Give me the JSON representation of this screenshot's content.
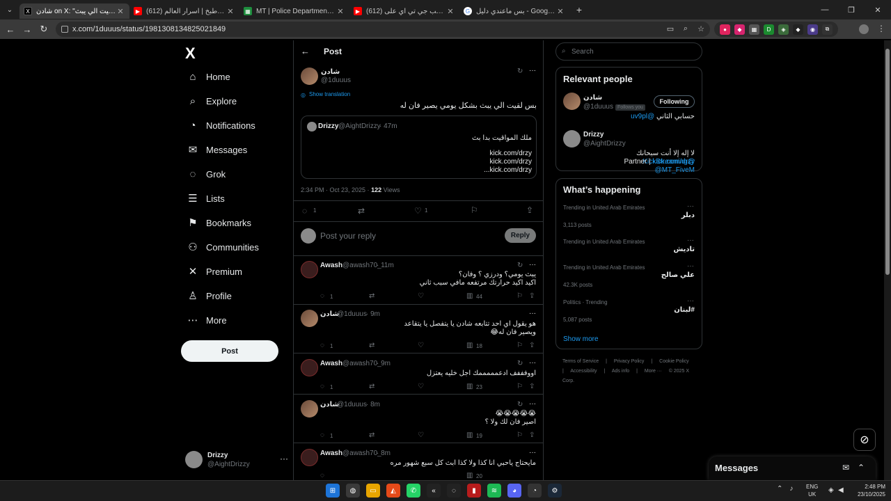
{
  "browser": {
    "tabs": [
      {
        "title": "شادن on X: \"بس لقيت الي يبث",
        "active": true,
        "fav_color": "#000000",
        "fav_glyph": "X"
      },
      {
        "title": "(612) سوالف و طبخ | اسرار العالم",
        "active": false,
        "fav_color": "#ff0000",
        "fav_glyph": "▶"
      },
      {
        "title": "MT | Police Departments v7.0 -",
        "active": false,
        "fav_color": "#1e8e3e",
        "fav_glyph": "▦"
      },
      {
        "title": "(612) كيف تلعب جي تي اي على",
        "active": false,
        "fav_color": "#ff0000",
        "fav_glyph": "▶"
      },
      {
        "title": "بس ماعندي دليل - Google Search",
        "active": false,
        "fav_color": "#ffffff",
        "fav_glyph": "G"
      }
    ],
    "url": "x.com/1duuus/status/1981308134825021849"
  },
  "sidebar": {
    "logo": "X",
    "items": [
      {
        "label": "Home",
        "icon": "home-icon",
        "glyph": "⌂"
      },
      {
        "label": "Explore",
        "icon": "search-icon",
        "glyph": "⌕"
      },
      {
        "label": "Notifications",
        "icon": "bell-icon",
        "glyph": "◔"
      },
      {
        "label": "Messages",
        "icon": "mail-icon",
        "glyph": "✉"
      },
      {
        "label": "Grok",
        "icon": "grok-icon",
        "glyph": "◌"
      },
      {
        "label": "Lists",
        "icon": "list-icon",
        "glyph": "☰"
      },
      {
        "label": "Bookmarks",
        "icon": "bookmark-icon",
        "glyph": "⚑"
      },
      {
        "label": "Communities",
        "icon": "people-icon",
        "glyph": "⚇"
      },
      {
        "label": "Premium",
        "icon": "x-premium-icon",
        "glyph": "✕"
      },
      {
        "label": "Profile",
        "icon": "person-icon",
        "glyph": "♙"
      },
      {
        "label": "More",
        "icon": "more-icon",
        "glyph": "⋯"
      }
    ],
    "post_label": "Post",
    "account": {
      "name": "Drizzy",
      "handle": "@AightDrizzy"
    }
  },
  "main": {
    "header_title": "Post",
    "post": {
      "name": "شادن",
      "handle": "@1duuus",
      "show_translation": "Show translation",
      "text": "بس لقيت الي يبث بشكل يومي يصير فان له",
      "quote": {
        "name": "Drizzy",
        "handle": "@AightDrizzy",
        "time": "· 47m",
        "line1": "ملك المواقيت بدا بث",
        "links": [
          "kick.com/drzy",
          "kick.com/drzy",
          "kick.com/drzy..."
        ]
      },
      "timestamp": "2:34 PM · Oct 23, 2025 ·",
      "views_count": "122",
      "views_label": "Views",
      "replies": "1",
      "likes": "1"
    },
    "reply_placeholder": "Post your reply",
    "reply_button": "Reply",
    "replies": [
      {
        "name": "Awash",
        "handle": "@awash70_",
        "time": "· 11m",
        "lines": [
          "يبث يومي؟ ودرزي ؟ وفان؟",
          "اكيد اكيد حرارتك مرتفعه مافي سبب ثاني"
        ],
        "replies": "1",
        "views": "44"
      },
      {
        "name": "شادن",
        "handle": "@1duuus",
        "time": "· 9m",
        "lines": [
          "هو يقول اي احد تتابعه شادن يا يتفصل يا يتقاعد",
          "ويصير فان له😂"
        ],
        "replies": "1",
        "views": "18"
      },
      {
        "name": "Awash",
        "handle": "@awash70_",
        "time": "· 9m",
        "lines": [
          "اووفففف ادعمممممك اجل خليه يعتزل"
        ],
        "replies": "1",
        "views": "23"
      },
      {
        "name": "شادن",
        "handle": "@1duuus",
        "time": "· 8m",
        "lines": [
          "😭😭😭😭😭",
          "اصير فان لك ولا ؟"
        ],
        "replies": "1",
        "views": "19"
      },
      {
        "name": "Awash",
        "handle": "@awash70_",
        "time": "· 8m",
        "lines": [
          "مايحتاج ياحبي انا كذا ولا كذا ابث كل سبع شهور مره"
        ],
        "replies": "",
        "views": "20"
      }
    ]
  },
  "right": {
    "search_placeholder": "Search",
    "relevant_title": "Relevant people",
    "people": [
      {
        "name": "شادن",
        "handle": "@1duuus",
        "follows_you": "Follows you",
        "button": "Following",
        "bio_text": "حسابي الثاني",
        "bio_link": "@uv9pl"
      },
      {
        "name": "Drizzy",
        "handle": "@AightDrizzy",
        "bio1_text": "لا إله إلا أنت سبحانك",
        "bio1_link": "@KickStreaming",
        "bio2_text": "Partner |",
        "bio2_links": "kick.com/drzy @MT_FiveM"
      }
    ],
    "happening_title": "What’s happening",
    "trends": [
      {
        "meta": "Trending in United Arab Emirates",
        "name": "دبلر",
        "count": "3,113 posts"
      },
      {
        "meta": "Trending in United Arab Emirates",
        "name": "تاديش",
        "count": ""
      },
      {
        "meta": "Trending in United Arab Emirates",
        "name": "علي صالح",
        "count": "42.3K posts"
      },
      {
        "meta": "Politics · Trending",
        "name": "#لبنان",
        "count": "5,087 posts"
      }
    ],
    "show_more": "Show more",
    "footer": [
      "Terms of Service",
      "|",
      "Privacy Policy",
      "|",
      "Cookie Policy",
      "|",
      "Accessibility",
      "|",
      "Ads info",
      "|",
      "More ···",
      "© 2025 X Corp."
    ]
  },
  "messages_drawer": {
    "title": "Messages"
  },
  "taskbar": {
    "lang1": "ENG",
    "lang2": "UK",
    "time": "2:48 PM",
    "date": "23/10/2025"
  }
}
